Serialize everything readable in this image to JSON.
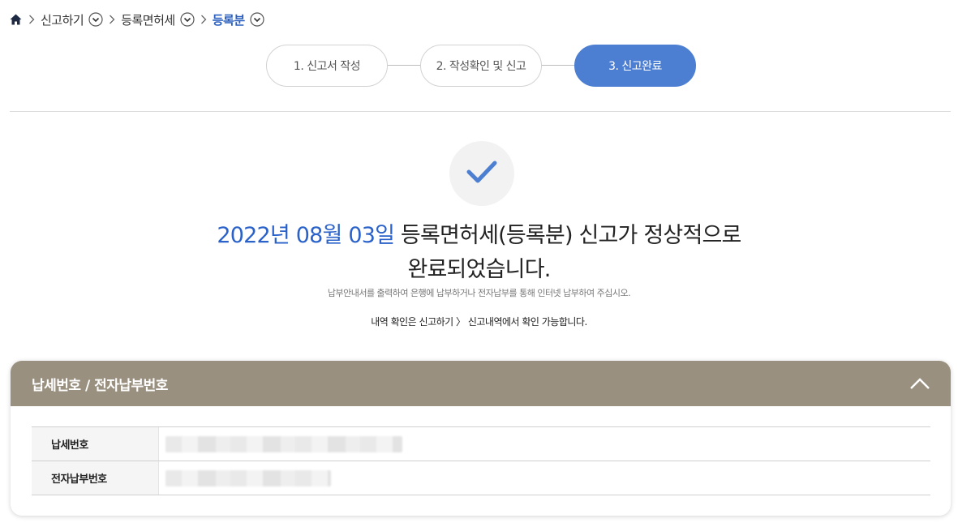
{
  "breadcrumb": {
    "items": [
      {
        "label": "신고하기"
      },
      {
        "label": "등록면허세"
      },
      {
        "label": "등록분"
      }
    ]
  },
  "stepper": {
    "steps": [
      {
        "label": "1. 신고서 작성",
        "active": false
      },
      {
        "label": "2. 작성확인 및 신고",
        "active": false
      },
      {
        "label": "3. 신고완료",
        "active": true
      }
    ]
  },
  "result": {
    "date": "2022년 08월 03일",
    "line1_rest": " 등록면허세(등록분) 신고가 정상적으로",
    "line2": "완료되었습니다.",
    "sub1": "납부안내서를 출력하여 은행에 납부하거나 전자납부를 통해 인터넷 납부하여 주십시오.",
    "sub2": "내역 확인은 신고하기 〉 신고내역에서 확인 가능합니다."
  },
  "panel": {
    "title": "납세번호 / 전자납부번호",
    "rows": [
      {
        "label": "납세번호",
        "value": ""
      },
      {
        "label": "전자납부번호",
        "value": ""
      }
    ]
  },
  "colors": {
    "accent_blue": "#4c7fd1",
    "date_blue": "#2a62c9",
    "panel_header": "#9a9080"
  }
}
